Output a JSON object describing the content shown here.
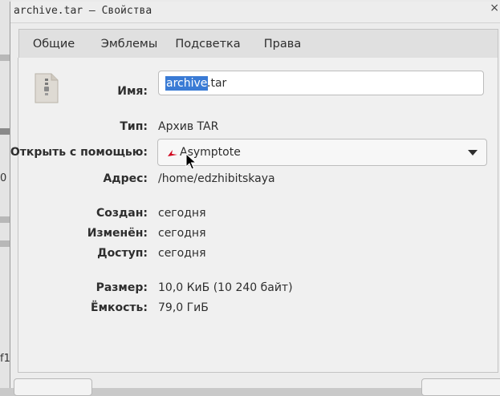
{
  "window": {
    "title": "archive.tar — Свойства",
    "close_glyph": "×"
  },
  "tabs": [
    {
      "label": "Общие",
      "active": true
    },
    {
      "label": "Эмблемы",
      "active": false
    },
    {
      "label": "Подсветка",
      "active": false
    },
    {
      "label": "Права",
      "active": false
    }
  ],
  "file": {
    "icon": "archive-file-icon",
    "name_label": "Имя:",
    "name_selected": "archive",
    "name_rest": ".tar",
    "type_label": "Тип:",
    "type_value": "Архив TAR",
    "open_with_label": "Открыть с помощью:",
    "open_with_value": "Asymptote",
    "open_with_icon": "asymptote-app-icon",
    "address_label": "Адрес:",
    "address_value": "/home/edzhibitskaya",
    "created_label": "Создан:",
    "created_value": "сегодня",
    "modified_label": "Изменён:",
    "modified_value": "сегодня",
    "accessed_label": "Доступ:",
    "accessed_value": "сегодня",
    "size_label": "Размер:",
    "size_value": "10,0 КиБ (10 240 байт)",
    "capacity_label": "Ёмкость:",
    "capacity_value": "79,0 ГиБ"
  },
  "background": {
    "chars": [
      "0",
      "f1"
    ]
  },
  "colors": {
    "accent": "#3584e4",
    "selection": "#3a7bd5",
    "asymptote_red": "#d0021b"
  }
}
